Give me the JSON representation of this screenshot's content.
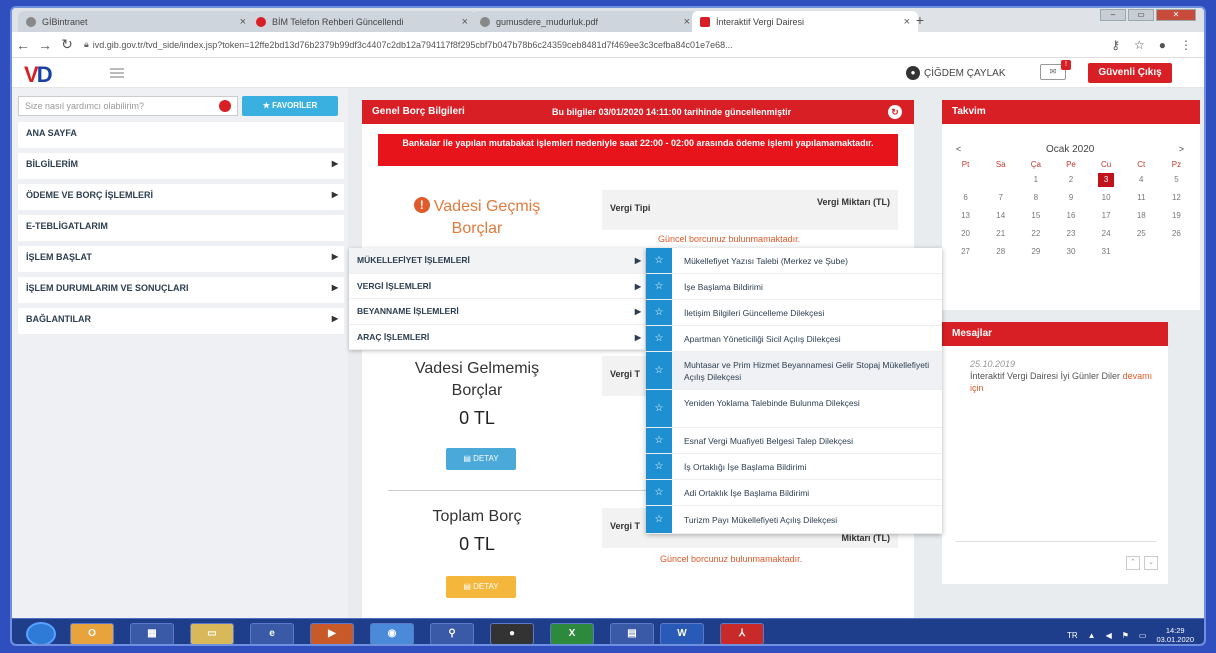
{
  "browser": {
    "tabs": [
      {
        "label": "GİBintranet",
        "icon_color": "#666"
      },
      {
        "label": "BİM Telefon Rehberi Güncellendi",
        "icon_color": "#d91f26"
      },
      {
        "label": "gumusdere_mudurluk.pdf",
        "icon_color": "#666"
      },
      {
        "label": "İnteraktif Vergi Dairesi",
        "icon_color": "#d91f26"
      }
    ],
    "url": "ivd.gib.gov.tr/tvd_side/index.jsp?token=12ffe2bd13d76b2379b99df3c4407c2db12a794117f8f295cbf7b047b78b6c24359ceb8481d7f469ee3c3cefba84c01e7e68..."
  },
  "header": {
    "logo_v": "V",
    "logo_d": "D",
    "user_name": "ÇİĞDEM ÇAYLAK",
    "logout_label": "Güvenli Çıkış"
  },
  "sidebar": {
    "search_placeholder": "Size nasıl yardımcı olabilirim?",
    "favorites_label": "FAVORİLER",
    "items": [
      {
        "label": "ANA SAYFA",
        "arrow": ""
      },
      {
        "label": "BİLGİLERİM",
        "arrow": "▶"
      },
      {
        "label": "ÖDEME VE BORÇ İŞLEMLERİ",
        "arrow": "▶"
      },
      {
        "label": "E-TEBLİGATLARIM",
        "arrow": ""
      },
      {
        "label": "İŞLEM BAŞLAT",
        "arrow": "▶"
      },
      {
        "label": "İŞLEM DURUMLARIM VE SONUÇLARI",
        "arrow": "▶"
      },
      {
        "label": "BAĞLANTILAR",
        "arrow": "▶"
      }
    ]
  },
  "debt_panel": {
    "title": "Genel Borç Bilgileri",
    "updated_info": "Bu bilgiler 03/01/2020 14:11:00 tarihinde güncellenmiştir",
    "alert": "Bankalar ile yapılan mutabakat işlemleri nedeniyle saat 22:00 - 02:00 arasında ödeme işlemi yapılamamaktadır.",
    "overdue_title": "Vadesi Geçmiş Borçlar",
    "col_type": "Vergi Tipi",
    "col_amount": "Vergi Miktarı (TL)",
    "no_debt_msg": "Güncel borcunuz bulunmamaktadır.",
    "notdue_title": "Vadesi Gelmemiş Borçlar",
    "notdue_amount": "0 TL",
    "notdue_type_partial": "Vergi T",
    "detail_label": "DETAY",
    "total_title": "Toplam Borç",
    "total_amount": "0 TL",
    "total_type_partial": "Vergi T",
    "total_amount_partial": "Miktarı (TL)"
  },
  "submenu_level1": [
    {
      "label": "MÜKELLEFİYET İŞLEMLERİ"
    },
    {
      "label": "VERGİ İŞLEMLERİ"
    },
    {
      "label": "BEYANNAME İŞLEMLERİ"
    },
    {
      "label": "ARAÇ İŞLEMLERİ"
    }
  ],
  "submenu_level2": [
    {
      "label": "Mükellefiyet Yazısı Talebi (Merkez ve Şube)"
    },
    {
      "label": "İşe Başlama Bildirimi"
    },
    {
      "label": "İletişim Bilgileri Güncelleme Dilekçesi"
    },
    {
      "label": "Apartman Yöneticiliği Sicil Açılış Dilekçesi"
    },
    {
      "label": "Muhtasar ve Prim Hizmet Beyannamesi Gelir Stopaj Mükellefiyeti Açılış Dilekçesi"
    },
    {
      "label": "Yeniden Yoklama Talebinde Bulunma Dilekçesi"
    },
    {
      "label": "Esnaf Vergi Muafiyeti Belgesi Talep Dilekçesi"
    },
    {
      "label": "İş Ortaklığı İşe Başlama Bildirimi"
    },
    {
      "label": "Adi Ortaklık İşe Başlama Bildirimi"
    },
    {
      "label": "Turizm Payı Mükellefiyeti Açılış Dilekçesi"
    }
  ],
  "calendar": {
    "title": "Takvim",
    "month": "Ocak 2020",
    "prev": "<",
    "next": ">",
    "weekdays": [
      "Pt",
      "Sa",
      "Ça",
      "Pe",
      "Cu",
      "Ct",
      "Pz"
    ],
    "days": [
      "",
      "",
      "1",
      "2",
      "3",
      "4",
      "5",
      "6",
      "7",
      "8",
      "9",
      "10",
      "11",
      "12",
      "13",
      "14",
      "15",
      "16",
      "17",
      "18",
      "19",
      "20",
      "21",
      "22",
      "23",
      "24",
      "25",
      "26",
      "27",
      "28",
      "29",
      "30",
      "31",
      "",
      "",
      ""
    ],
    "today": "3"
  },
  "messages": {
    "title": "Mesajlar",
    "date": "25.10.2019",
    "text": "İnteraktif Vergi Dairesi İyi Günler Diler",
    "link": "devamı için"
  },
  "taskbar": {
    "lang": "TR",
    "time": "14:29",
    "date": "03.01.2020"
  },
  "colors": {
    "brand_red": "#d91f26",
    "brand_blue": "#1a3fa8",
    "star_blue": "#1e8fd0"
  }
}
